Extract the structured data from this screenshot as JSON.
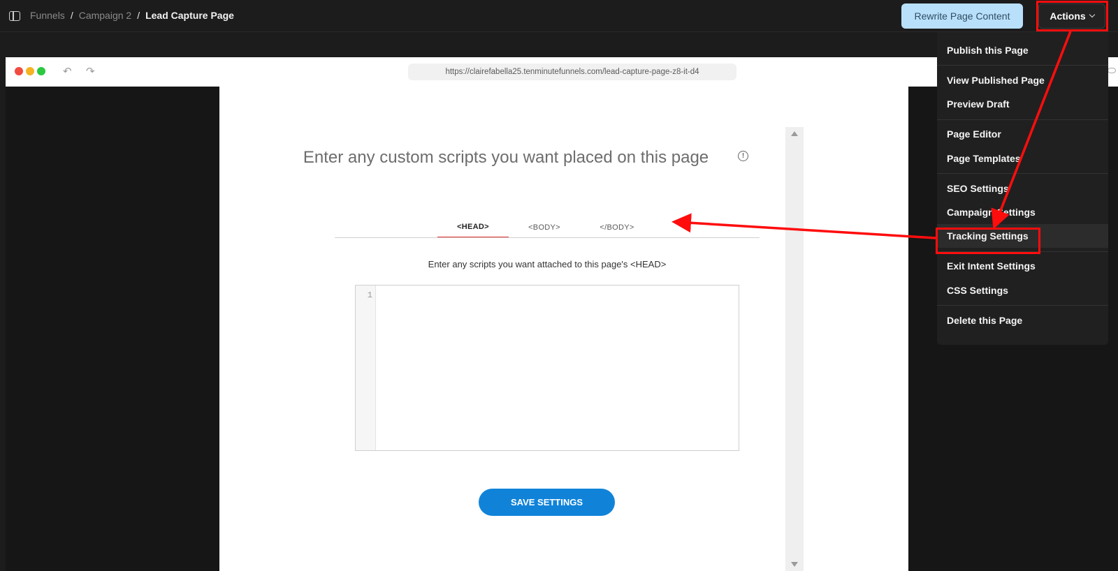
{
  "breadcrumb": {
    "items": [
      "Funnels",
      "Campaign 2"
    ],
    "current": "Lead Capture Page",
    "separator": "/"
  },
  "header": {
    "rewrite_label": "Rewrite Page Content",
    "actions_label": "Actions"
  },
  "browser": {
    "url": "https://clairefabella25.tenminutefunnels.com/lead-capture-page-z8-it-d4"
  },
  "tracking_panel": {
    "title": "Enter any custom scripts you want placed on this page",
    "tabs": [
      {
        "label": "<HEAD>",
        "active": true
      },
      {
        "label": "<BODY>",
        "active": false
      },
      {
        "label": "</BODY>",
        "active": false
      }
    ],
    "description": "Enter any scripts you want attached to this page's <HEAD>",
    "editor_line_number": "1",
    "save_label": "SAVE SETTINGS"
  },
  "actions_menu": {
    "items": [
      "Publish this Page",
      "View Published Page",
      "Preview Draft",
      "Page Editor",
      "Page Templates",
      "SEO Settings",
      "Campaign Settings",
      "Tracking Settings",
      "Exit Intent Settings",
      "CSS Settings",
      "Delete this Page"
    ],
    "highlighted": "Tracking Settings"
  },
  "colors": {
    "annotation": "#ff0d0d",
    "save_button": "#1083d9",
    "rewrite_button": "#b9e0fb",
    "active_tab_underline": "#e53935"
  }
}
